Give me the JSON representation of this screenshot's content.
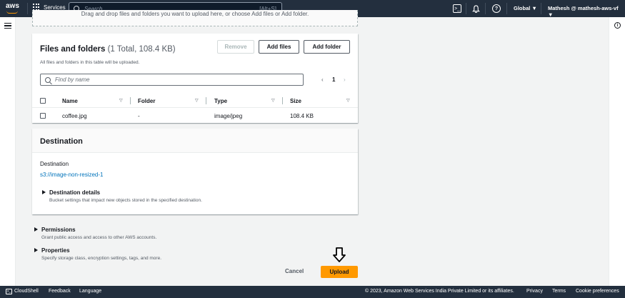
{
  "topnav": {
    "logo": "aws",
    "services_label": "Services",
    "search_placeholder": "Search",
    "search_shortcut": "[Alt+S]",
    "region": "Global ▼",
    "account": "Mathesh @ mathesh-aws-vf ▼"
  },
  "dropzone": {
    "text": "Drag and drop files and folders you want to upload here, or choose Add files or Add folder."
  },
  "files_panel": {
    "title": "Files and folders",
    "count": "(1 Total, 108.4 KB)",
    "description": "All files and folders in this table will be uploaded.",
    "remove_label": "Remove",
    "add_files_label": "Add files",
    "add_folder_label": "Add folder",
    "filter_placeholder": "Find by name",
    "page": "1",
    "columns": [
      "Name",
      "Folder",
      "Type",
      "Size"
    ],
    "rows": [
      {
        "name": "coffee.jpg",
        "folder": "-",
        "type": "image/jpeg",
        "size": "108.4 KB"
      }
    ]
  },
  "destination": {
    "title": "Destination",
    "label": "Destination",
    "link": "s3://image-non-resized-1",
    "details_title": "Destination details",
    "details_desc": "Bucket settings that impact new objects stored in the specified destination."
  },
  "permissions": {
    "title": "Permissions",
    "desc": "Grant public access and access to other AWS accounts."
  },
  "properties": {
    "title": "Properties",
    "desc": "Specify storage class, encryption settings, tags, and more."
  },
  "actions": {
    "cancel_label": "Cancel",
    "upload_label": "Upload"
  },
  "footer": {
    "cloudshell": "CloudShell",
    "feedback": "Feedback",
    "language": "Language",
    "copyright": "© 2023, Amazon Web Services India Private Limited or its affiliates.",
    "privacy": "Privacy",
    "terms": "Terms",
    "cookies": "Cookie preferences"
  },
  "colors": {
    "nav_bg": "#232f3e",
    "accent": "#ff9900",
    "link": "#0073bb"
  }
}
